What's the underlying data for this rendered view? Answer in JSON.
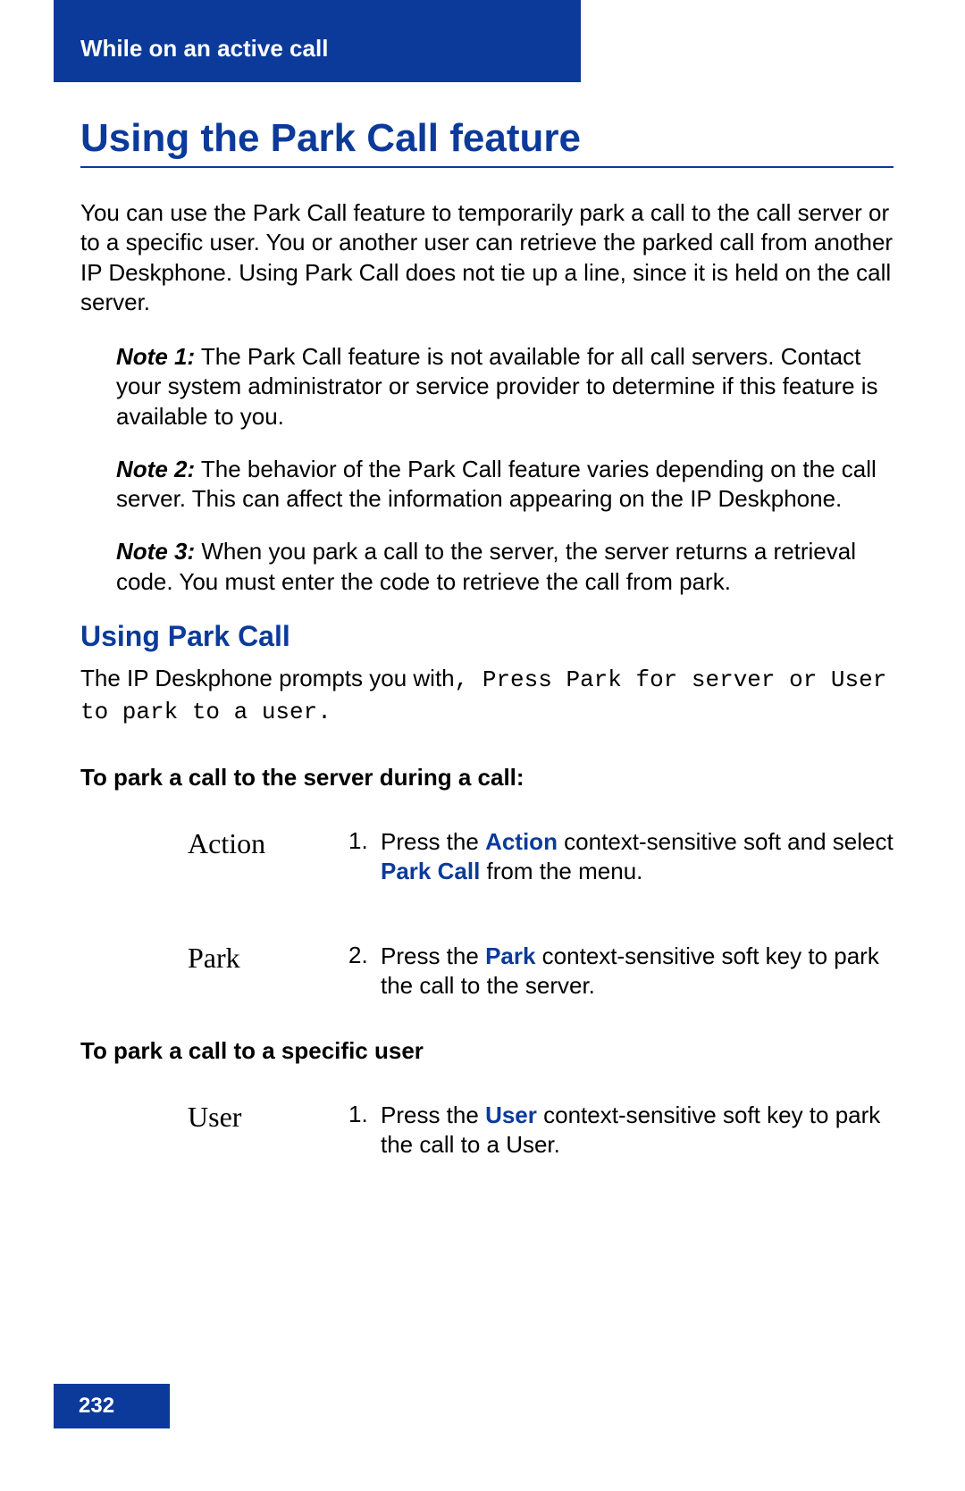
{
  "header": {
    "section": "While on an active call"
  },
  "title": "Using the Park Call feature",
  "intro": "You can use the Park Call feature to temporarily park a call to the call server or to a specific user. You or another user can retrieve the parked call from another IP Deskphone. Using Park Call does not tie up a line, since it is held on the call server.",
  "notes": [
    {
      "label": "Note 1:",
      "text": "  The Park Call feature is not available for all call servers. Contact your system administrator or service provider to determine if this feature is available to you."
    },
    {
      "label": "Note 2:",
      "text": "  The behavior of the Park Call feature varies depending on the call server. This can affect the information appearing on the IP Deskphone."
    },
    {
      "label": "Note 3:",
      "text": "  When you park a call to the server, the server returns a retrieval code. You must enter the code to retrieve the call from park."
    }
  ],
  "subhead": "Using Park Call",
  "prompt": {
    "lead": "The IP Deskphone prompts you with",
    "mono": ", Press Park for server or User to park to a user."
  },
  "tasks": {
    "server": {
      "heading": "To park a call to the server during a call:",
      "steps": [
        {
          "key": "Action",
          "num": "1.",
          "pre": "Press the ",
          "kw1": "Action",
          "mid": " context-sensitive soft and select ",
          "kw2": "Park Call",
          "post": " from the menu."
        },
        {
          "key": "Park",
          "num": "2.",
          "pre": "Press the ",
          "kw1": "Park",
          "mid": " context-sensitive soft key to park the call to the server.",
          "kw2": "",
          "post": ""
        }
      ]
    },
    "user": {
      "heading": "To park a call to a specific user",
      "steps": [
        {
          "key": "User",
          "num": "1.",
          "pre": "Press the ",
          "kw1": "User",
          "mid": " context-sensitive soft key to park the call to a User.",
          "kw2": "",
          "post": ""
        }
      ]
    }
  },
  "page_number": "232"
}
